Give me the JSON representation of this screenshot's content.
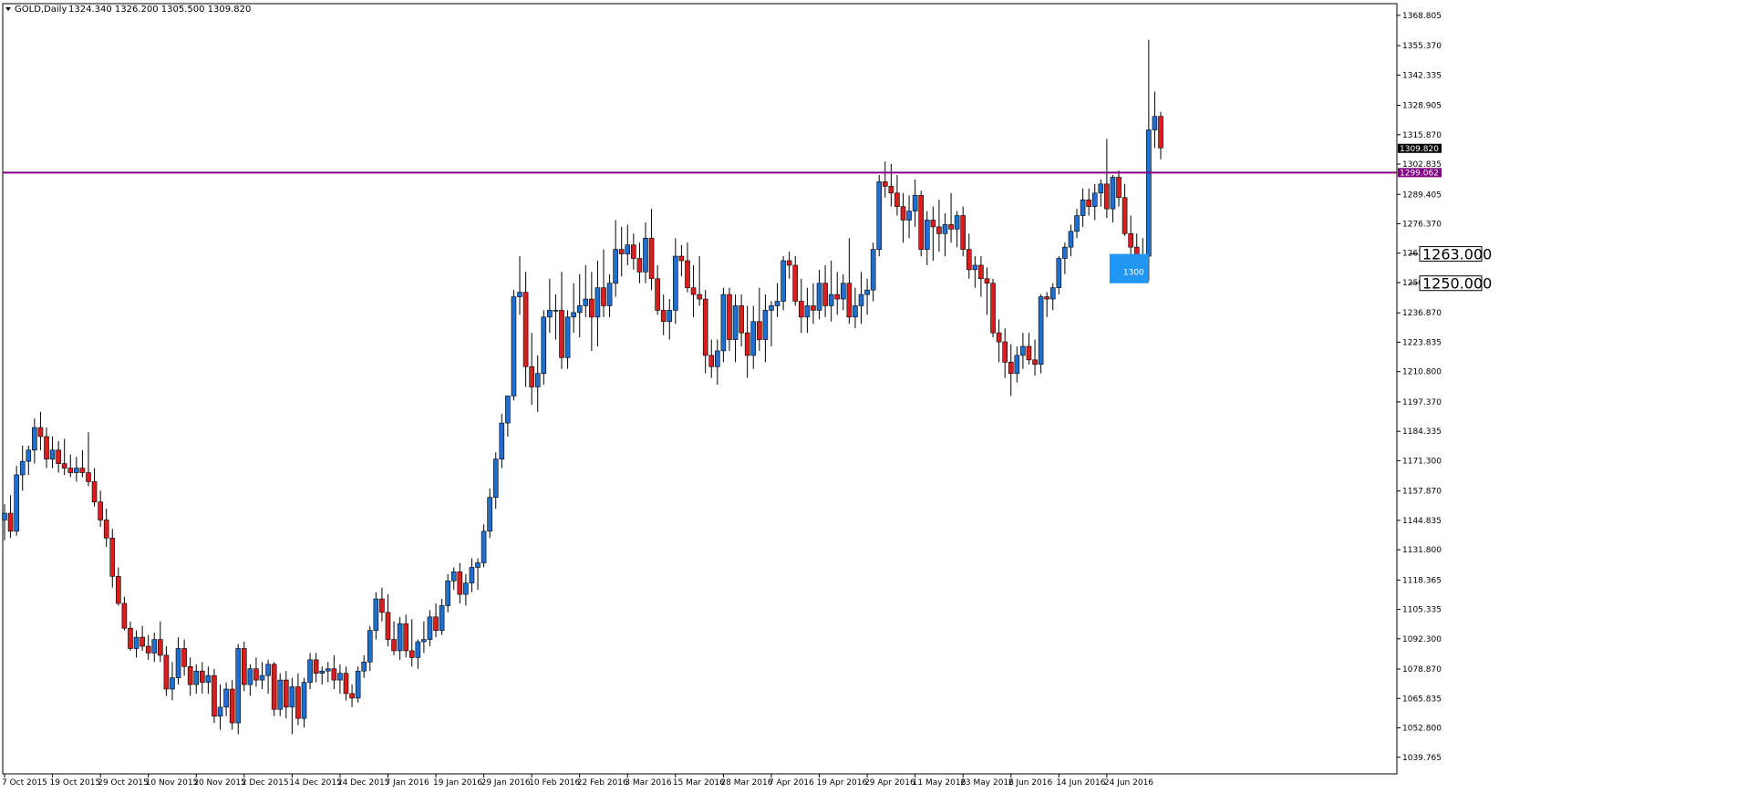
{
  "header": {
    "dropdown_icon": "triangle-down-icon",
    "symbol": "GOLD,Daily",
    "ohlc": "1324.340 1326.200 1305.500 1309.820"
  },
  "colors": {
    "background": "#ffffff",
    "axis": "#000000",
    "bull": "#1f6fd1",
    "bear": "#d81e1e",
    "wick": "#000000",
    "hline": "#800080",
    "price_tag_bg": "#000000",
    "price_tag_fg": "#ffffff",
    "box_fill": "#2196f3",
    "box_text": "#ffffff"
  },
  "chart_data": {
    "type": "candlestick",
    "instrument": "GOLD",
    "timeframe": "Daily",
    "ylim": [
      1032.4,
      1374.0
    ],
    "grid": false,
    "y_ticks": [
      "1368.805",
      "1355.370",
      "1342.335",
      "1328.905",
      "1315.870",
      "1302.835",
      "1289.405",
      "1276.370",
      "1263.335",
      "1250.300",
      "1236.870",
      "1223.835",
      "1210.800",
      "1197.370",
      "1184.335",
      "1171.300",
      "1157.870",
      "1144.835",
      "1131.800",
      "1118.365",
      "1105.335",
      "1092.300",
      "1078.870",
      "1065.835",
      "1052.800",
      "1039.765"
    ],
    "x_ticks": [
      {
        "label": "7 Oct 2015",
        "i": 0
      },
      {
        "label": "19 Oct 2015",
        "i": 8
      },
      {
        "label": "29 Oct 2015",
        "i": 16
      },
      {
        "label": "10 Nov 2015",
        "i": 24
      },
      {
        "label": "20 Nov 2015",
        "i": 32
      },
      {
        "label": "2 Dec 2015",
        "i": 40
      },
      {
        "label": "14 Dec 2015",
        "i": 48
      },
      {
        "label": "24 Dec 2015",
        "i": 56
      },
      {
        "label": "7 Jan 2016",
        "i": 64
      },
      {
        "label": "19 Jan 2016",
        "i": 72
      },
      {
        "label": "29 Jan 2016",
        "i": 80
      },
      {
        "label": "10 Feb 2016",
        "i": 88
      },
      {
        "label": "22 Feb 2016",
        "i": 96
      },
      {
        "label": "3 Mar 2016",
        "i": 104
      },
      {
        "label": "15 Mar 2016",
        "i": 112
      },
      {
        "label": "28 Mar 2016",
        "i": 120
      },
      {
        "label": "7 Apr 2016",
        "i": 128
      },
      {
        "label": "19 Apr 2016",
        "i": 136
      },
      {
        "label": "29 Apr 2016",
        "i": 144
      },
      {
        "label": "11 May 2016",
        "i": 152
      },
      {
        "label": "23 May 2016",
        "i": 160
      },
      {
        "label": "2 Jun 2016",
        "i": 168
      },
      {
        "label": "14 Jun 2016",
        "i": 176
      },
      {
        "label": "24 Jun 2016",
        "i": 184
      }
    ],
    "candles": [
      [
        1145,
        1152,
        1136,
        1148
      ],
      [
        1148,
        1156,
        1137,
        1140
      ],
      [
        1140,
        1169,
        1138,
        1165
      ],
      [
        1165,
        1178,
        1158,
        1171
      ],
      [
        1171,
        1178,
        1165,
        1176
      ],
      [
        1176,
        1190,
        1170,
        1186
      ],
      [
        1186,
        1193,
        1176,
        1182
      ],
      [
        1182,
        1186,
        1168,
        1172
      ],
      [
        1172,
        1182,
        1168,
        1176
      ],
      [
        1176,
        1180,
        1166,
        1170
      ],
      [
        1170,
        1181,
        1165,
        1168
      ],
      [
        1168,
        1174,
        1164,
        1166
      ],
      [
        1166,
        1173,
        1162,
        1168
      ],
      [
        1168,
        1176,
        1164,
        1166
      ],
      [
        1166,
        1184,
        1160,
        1162
      ],
      [
        1162,
        1168,
        1151,
        1153
      ],
      [
        1153,
        1158,
        1142,
        1145
      ],
      [
        1145,
        1150,
        1133,
        1137
      ],
      [
        1137,
        1141,
        1115,
        1120
      ],
      [
        1120,
        1124,
        1107,
        1108
      ],
      [
        1108,
        1111,
        1096,
        1097
      ],
      [
        1097,
        1100,
        1087,
        1088
      ],
      [
        1088,
        1096,
        1084,
        1093
      ],
      [
        1093,
        1098,
        1087,
        1089
      ],
      [
        1089,
        1094,
        1083,
        1086
      ],
      [
        1086,
        1095,
        1082,
        1092
      ],
      [
        1092,
        1100,
        1082,
        1085
      ],
      [
        1085,
        1089,
        1067,
        1070
      ],
      [
        1070,
        1082,
        1065,
        1075
      ],
      [
        1075,
        1093,
        1072,
        1088
      ],
      [
        1088,
        1092,
        1076,
        1080
      ],
      [
        1080,
        1084,
        1067,
        1072
      ],
      [
        1072,
        1081,
        1068,
        1078
      ],
      [
        1078,
        1082,
        1068,
        1073
      ],
      [
        1073,
        1080,
        1068,
        1076
      ],
      [
        1076,
        1079,
        1055,
        1058
      ],
      [
        1058,
        1072,
        1052,
        1062
      ],
      [
        1062,
        1073,
        1058,
        1070
      ],
      [
        1070,
        1074,
        1052,
        1055
      ],
      [
        1055,
        1090,
        1050,
        1088
      ],
      [
        1088,
        1091,
        1069,
        1072
      ],
      [
        1072,
        1081,
        1067,
        1079
      ],
      [
        1079,
        1084,
        1071,
        1074
      ],
      [
        1074,
        1082,
        1070,
        1076
      ],
      [
        1076,
        1083,
        1068,
        1081
      ],
      [
        1081,
        1082,
        1058,
        1061
      ],
      [
        1061,
        1077,
        1058,
        1074
      ],
      [
        1074,
        1078,
        1057,
        1062
      ],
      [
        1062,
        1075,
        1050,
        1071
      ],
      [
        1071,
        1077,
        1054,
        1057
      ],
      [
        1057,
        1075,
        1053,
        1073
      ],
      [
        1073,
        1086,
        1070,
        1083
      ],
      [
        1083,
        1086,
        1073,
        1077
      ],
      [
        1077,
        1080,
        1072,
        1078
      ],
      [
        1078,
        1082,
        1073,
        1079
      ],
      [
        1079,
        1085,
        1070,
        1074
      ],
      [
        1074,
        1081,
        1068,
        1077
      ],
      [
        1077,
        1080,
        1065,
        1068
      ],
      [
        1068,
        1072,
        1062,
        1066
      ],
      [
        1066,
        1080,
        1064,
        1078
      ],
      [
        1078,
        1085,
        1075,
        1082
      ],
      [
        1082,
        1098,
        1078,
        1096
      ],
      [
        1096,
        1113,
        1092,
        1110
      ],
      [
        1110,
        1115,
        1100,
        1104
      ],
      [
        1104,
        1112,
        1089,
        1092
      ],
      [
        1092,
        1100,
        1085,
        1087
      ],
      [
        1087,
        1102,
        1083,
        1099
      ],
      [
        1099,
        1103,
        1084,
        1087
      ],
      [
        1087,
        1101,
        1080,
        1084
      ],
      [
        1084,
        1092,
        1079,
        1091
      ],
      [
        1091,
        1100,
        1086,
        1092
      ],
      [
        1092,
        1105,
        1089,
        1102
      ],
      [
        1102,
        1108,
        1093,
        1096
      ],
      [
        1096,
        1110,
        1094,
        1107
      ],
      [
        1107,
        1121,
        1104,
        1118
      ],
      [
        1118,
        1124,
        1114,
        1122
      ],
      [
        1122,
        1126,
        1108,
        1112
      ],
      [
        1112,
        1121,
        1107,
        1117
      ],
      [
        1117,
        1128,
        1113,
        1124
      ],
      [
        1124,
        1128,
        1114,
        1126
      ],
      [
        1126,
        1143,
        1124,
        1140
      ],
      [
        1140,
        1159,
        1137,
        1155
      ],
      [
        1155,
        1175,
        1150,
        1172
      ],
      [
        1172,
        1192,
        1168,
        1188
      ],
      [
        1188,
        1196,
        1182,
        1200
      ],
      [
        1200,
        1247,
        1198,
        1244
      ],
      [
        1244,
        1262,
        1236,
        1246
      ],
      [
        1246,
        1255,
        1204,
        1213
      ],
      [
        1213,
        1228,
        1196,
        1204
      ],
      [
        1204,
        1218,
        1193,
        1210
      ],
      [
        1210,
        1238,
        1205,
        1235
      ],
      [
        1235,
        1252,
        1228,
        1238
      ],
      [
        1238,
        1245,
        1225,
        1238
      ],
      [
        1238,
        1255,
        1212,
        1217
      ],
      [
        1217,
        1238,
        1212,
        1235
      ],
      [
        1235,
        1250,
        1228,
        1237
      ],
      [
        1237,
        1254,
        1226,
        1240
      ],
      [
        1240,
        1258,
        1235,
        1243
      ],
      [
        1243,
        1255,
        1220,
        1235
      ],
      [
        1235,
        1260,
        1222,
        1248
      ],
      [
        1248,
        1265,
        1235,
        1240
      ],
      [
        1240,
        1254,
        1235,
        1250
      ],
      [
        1250,
        1278,
        1244,
        1265
      ],
      [
        1265,
        1275,
        1253,
        1263
      ],
      [
        1263,
        1276,
        1258,
        1267
      ],
      [
        1267,
        1272,
        1256,
        1261
      ],
      [
        1261,
        1268,
        1250,
        1255
      ],
      [
        1255,
        1277,
        1250,
        1270
      ],
      [
        1270,
        1283,
        1247,
        1252
      ],
      [
        1252,
        1258,
        1236,
        1238
      ],
      [
        1238,
        1245,
        1227,
        1233
      ],
      [
        1233,
        1243,
        1225,
        1238
      ],
      [
        1238,
        1270,
        1232,
        1262
      ],
      [
        1262,
        1267,
        1253,
        1260
      ],
      [
        1260,
        1268,
        1246,
        1248
      ],
      [
        1248,
        1258,
        1235,
        1245
      ],
      [
        1245,
        1262,
        1240,
        1243
      ],
      [
        1243,
        1247,
        1210,
        1218
      ],
      [
        1218,
        1225,
        1208,
        1213
      ],
      [
        1213,
        1225,
        1205,
        1220
      ],
      [
        1220,
        1248,
        1215,
        1245
      ],
      [
        1245,
        1248,
        1220,
        1225
      ],
      [
        1225,
        1245,
        1215,
        1240
      ],
      [
        1240,
        1245,
        1222,
        1228
      ],
      [
        1228,
        1240,
        1208,
        1218
      ],
      [
        1218,
        1240,
        1212,
        1233
      ],
      [
        1233,
        1248,
        1220,
        1225
      ],
      [
        1225,
        1245,
        1215,
        1238
      ],
      [
        1238,
        1242,
        1222,
        1240
      ],
      [
        1240,
        1250,
        1235,
        1242
      ],
      [
        1242,
        1262,
        1238,
        1260
      ],
      [
        1260,
        1264,
        1252,
        1258
      ],
      [
        1258,
        1262,
        1240,
        1242
      ],
      [
        1242,
        1252,
        1228,
        1235
      ],
      [
        1235,
        1248,
        1228,
        1240
      ],
      [
        1240,
        1250,
        1232,
        1238
      ],
      [
        1238,
        1256,
        1234,
        1250
      ],
      [
        1250,
        1258,
        1235,
        1240
      ],
      [
        1240,
        1260,
        1233,
        1245
      ],
      [
        1245,
        1255,
        1236,
        1243
      ],
      [
        1243,
        1254,
        1238,
        1250
      ],
      [
        1250,
        1270,
        1232,
        1235
      ],
      [
        1235,
        1248,
        1230,
        1240
      ],
      [
        1240,
        1255,
        1232,
        1245
      ],
      [
        1245,
        1252,
        1236,
        1247
      ],
      [
        1247,
        1268,
        1242,
        1265
      ],
      [
        1265,
        1298,
        1262,
        1295
      ],
      [
        1295,
        1304,
        1288,
        1293
      ],
      [
        1293,
        1303,
        1284,
        1290
      ],
      [
        1290,
        1298,
        1280,
        1284
      ],
      [
        1284,
        1290,
        1268,
        1278
      ],
      [
        1278,
        1289,
        1270,
        1282
      ],
      [
        1282,
        1296,
        1275,
        1289
      ],
      [
        1289,
        1291,
        1262,
        1265
      ],
      [
        1265,
        1282,
        1258,
        1278
      ],
      [
        1278,
        1284,
        1260,
        1275
      ],
      [
        1275,
        1287,
        1264,
        1272
      ],
      [
        1272,
        1281,
        1262,
        1276
      ],
      [
        1276,
        1290,
        1268,
        1274
      ],
      [
        1274,
        1282,
        1266,
        1280
      ],
      [
        1280,
        1284,
        1262,
        1265
      ],
      [
        1265,
        1272,
        1252,
        1256
      ],
      [
        1256,
        1262,
        1248,
        1258
      ],
      [
        1258,
        1262,
        1244,
        1252
      ],
      [
        1252,
        1257,
        1236,
        1250
      ],
      [
        1250,
        1252,
        1226,
        1228
      ],
      [
        1228,
        1234,
        1215,
        1224
      ],
      [
        1224,
        1230,
        1208,
        1215
      ],
      [
        1215,
        1223,
        1200,
        1210
      ],
      [
        1210,
        1222,
        1206,
        1218
      ],
      [
        1218,
        1228,
        1212,
        1222
      ],
      [
        1222,
        1228,
        1214,
        1216
      ],
      [
        1216,
        1225,
        1209,
        1214
      ],
      [
        1214,
        1245,
        1210,
        1244
      ],
      [
        1244,
        1246,
        1235,
        1243
      ],
      [
        1243,
        1250,
        1238,
        1248
      ],
      [
        1248,
        1262,
        1245,
        1261
      ],
      [
        1261,
        1268,
        1254,
        1266
      ],
      [
        1266,
        1276,
        1262,
        1273
      ],
      [
        1273,
        1283,
        1270,
        1280
      ],
      [
        1280,
        1292,
        1275,
        1287
      ],
      [
        1287,
        1292,
        1280,
        1284
      ],
      [
        1284,
        1294,
        1278,
        1290
      ],
      [
        1290,
        1296,
        1284,
        1294
      ],
      [
        1294,
        1314,
        1279,
        1283
      ],
      [
        1283,
        1298,
        1277,
        1297
      ],
      [
        1297,
        1300,
        1284,
        1288
      ],
      [
        1288,
        1294,
        1271,
        1272
      ],
      [
        1272,
        1280,
        1260,
        1266
      ],
      [
        1266,
        1272,
        1250,
        1258
      ],
      [
        1258,
        1270,
        1250,
        1262
      ],
      [
        1262,
        1358,
        1251,
        1318
      ],
      [
        1318,
        1335,
        1310,
        1324
      ],
      [
        1324,
        1326,
        1305,
        1310
      ]
    ],
    "horizontal_lines": [
      {
        "price": 1299.062,
        "label": "1299.062"
      }
    ],
    "current_price": {
      "price": 1309.82,
      "label": "1309.820"
    },
    "annotations": {
      "box_text": "1300",
      "level_1": "1263.000",
      "level_1_price": 1263.0,
      "level_2": "1250.000",
      "level_2_price": 1250.0
    }
  }
}
